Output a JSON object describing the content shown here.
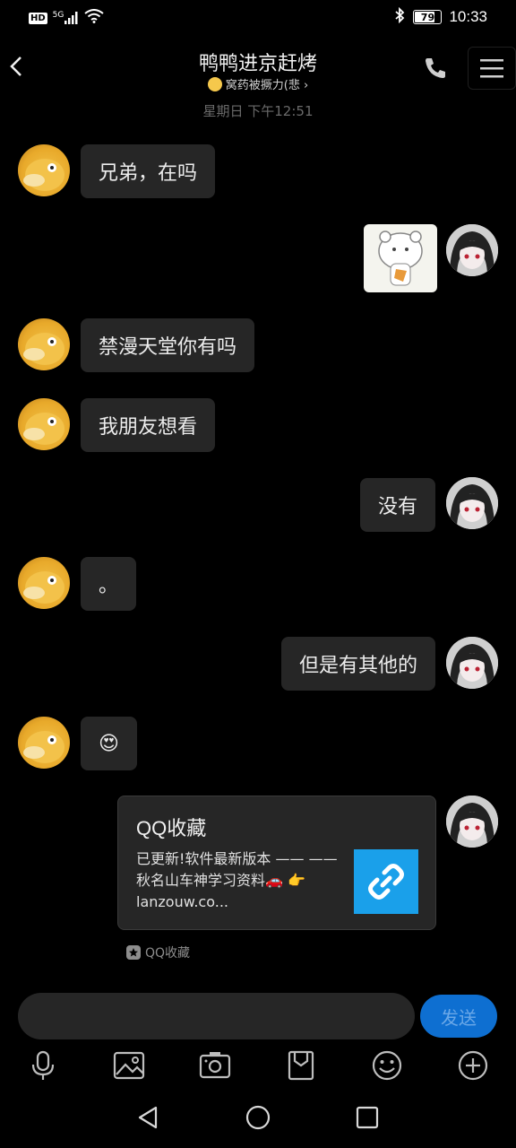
{
  "status_bar": {
    "left_indicators": "HD",
    "network": "5G",
    "battery": "79",
    "time": "10:33"
  },
  "header": {
    "title": "鸭鸭进京赶烤",
    "subtitle": "窝药被撅力(悲",
    "subtitle_chevron": "›"
  },
  "time_label": "星期日 下午12:51",
  "messages": [
    {
      "side": "left",
      "text": "兄弟，在吗"
    },
    {
      "side": "right",
      "type": "sticker",
      "sticker": "bear-sticker"
    },
    {
      "side": "left",
      "text": "禁漫天堂你有吗"
    },
    {
      "side": "left",
      "text": "我朋友想看"
    },
    {
      "side": "right",
      "text": "没有"
    },
    {
      "side": "left",
      "text": "。"
    },
    {
      "side": "right",
      "text": "但是有其他的"
    },
    {
      "side": "left",
      "text": "😍"
    },
    {
      "side": "right",
      "type": "card"
    }
  ],
  "card": {
    "title": "QQ收藏",
    "description": "已更新!软件最新版本 —— —— 秋名山车神学习资料🚗 👉lanzouw.co...",
    "thumbnail_icon": "link-icon",
    "source": "QQ收藏"
  },
  "composer": {
    "input_value": "",
    "send_label": "发送"
  },
  "toolbar": [
    "microphone-icon",
    "image-icon",
    "camera-icon",
    "file-icon",
    "emoji-icon",
    "plus-icon"
  ],
  "colors": {
    "background": "#000000",
    "bubble": "#262626",
    "send_button": "#0e6fd1",
    "card_thumb": "#1aa0ea"
  }
}
